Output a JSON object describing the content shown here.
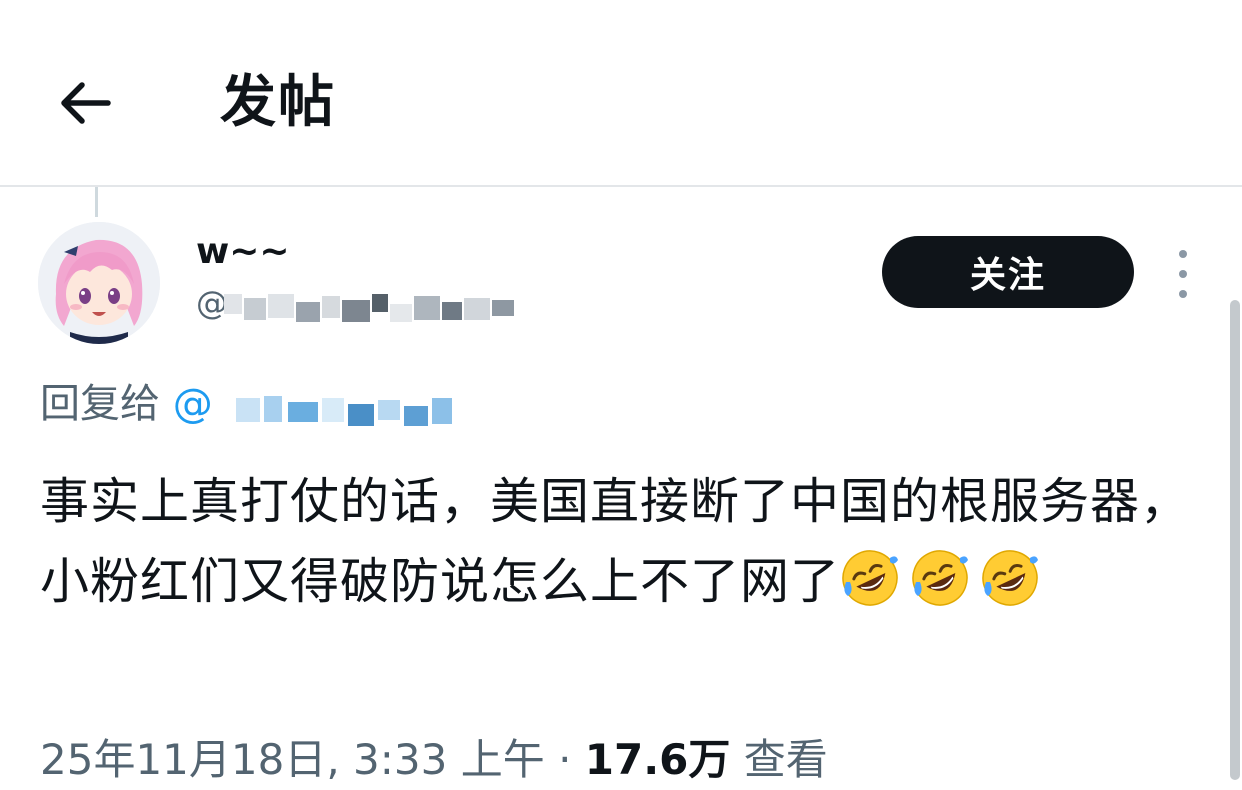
{
  "header": {
    "back_icon": "arrow-left-icon",
    "title": "发帖"
  },
  "post": {
    "author": {
      "display_name": "w~~",
      "handle_prefix": "@"
    },
    "follow_label": "关注",
    "more_icon": "more-vertical-icon",
    "reply_to": {
      "label": "回复给",
      "mention_prefix": "@"
    },
    "text": "事实上真打仗的话，美国直接断了中国的根服务器，小粉红们又得破防说怎么上不了网了",
    "emoji_name": "rolling-on-the-floor-laughing",
    "emoji_count": 3,
    "meta": {
      "timestamp": "25年11月18日, 3:33 上午",
      "separator": "·",
      "views_count": "17.6万",
      "views_label": "查看"
    }
  },
  "colors": {
    "text_primary": "#0f1419",
    "text_secondary": "#536471",
    "link": "#1d9bf0",
    "follow_bg": "#0f1419",
    "divider": "#e3e6e9"
  }
}
